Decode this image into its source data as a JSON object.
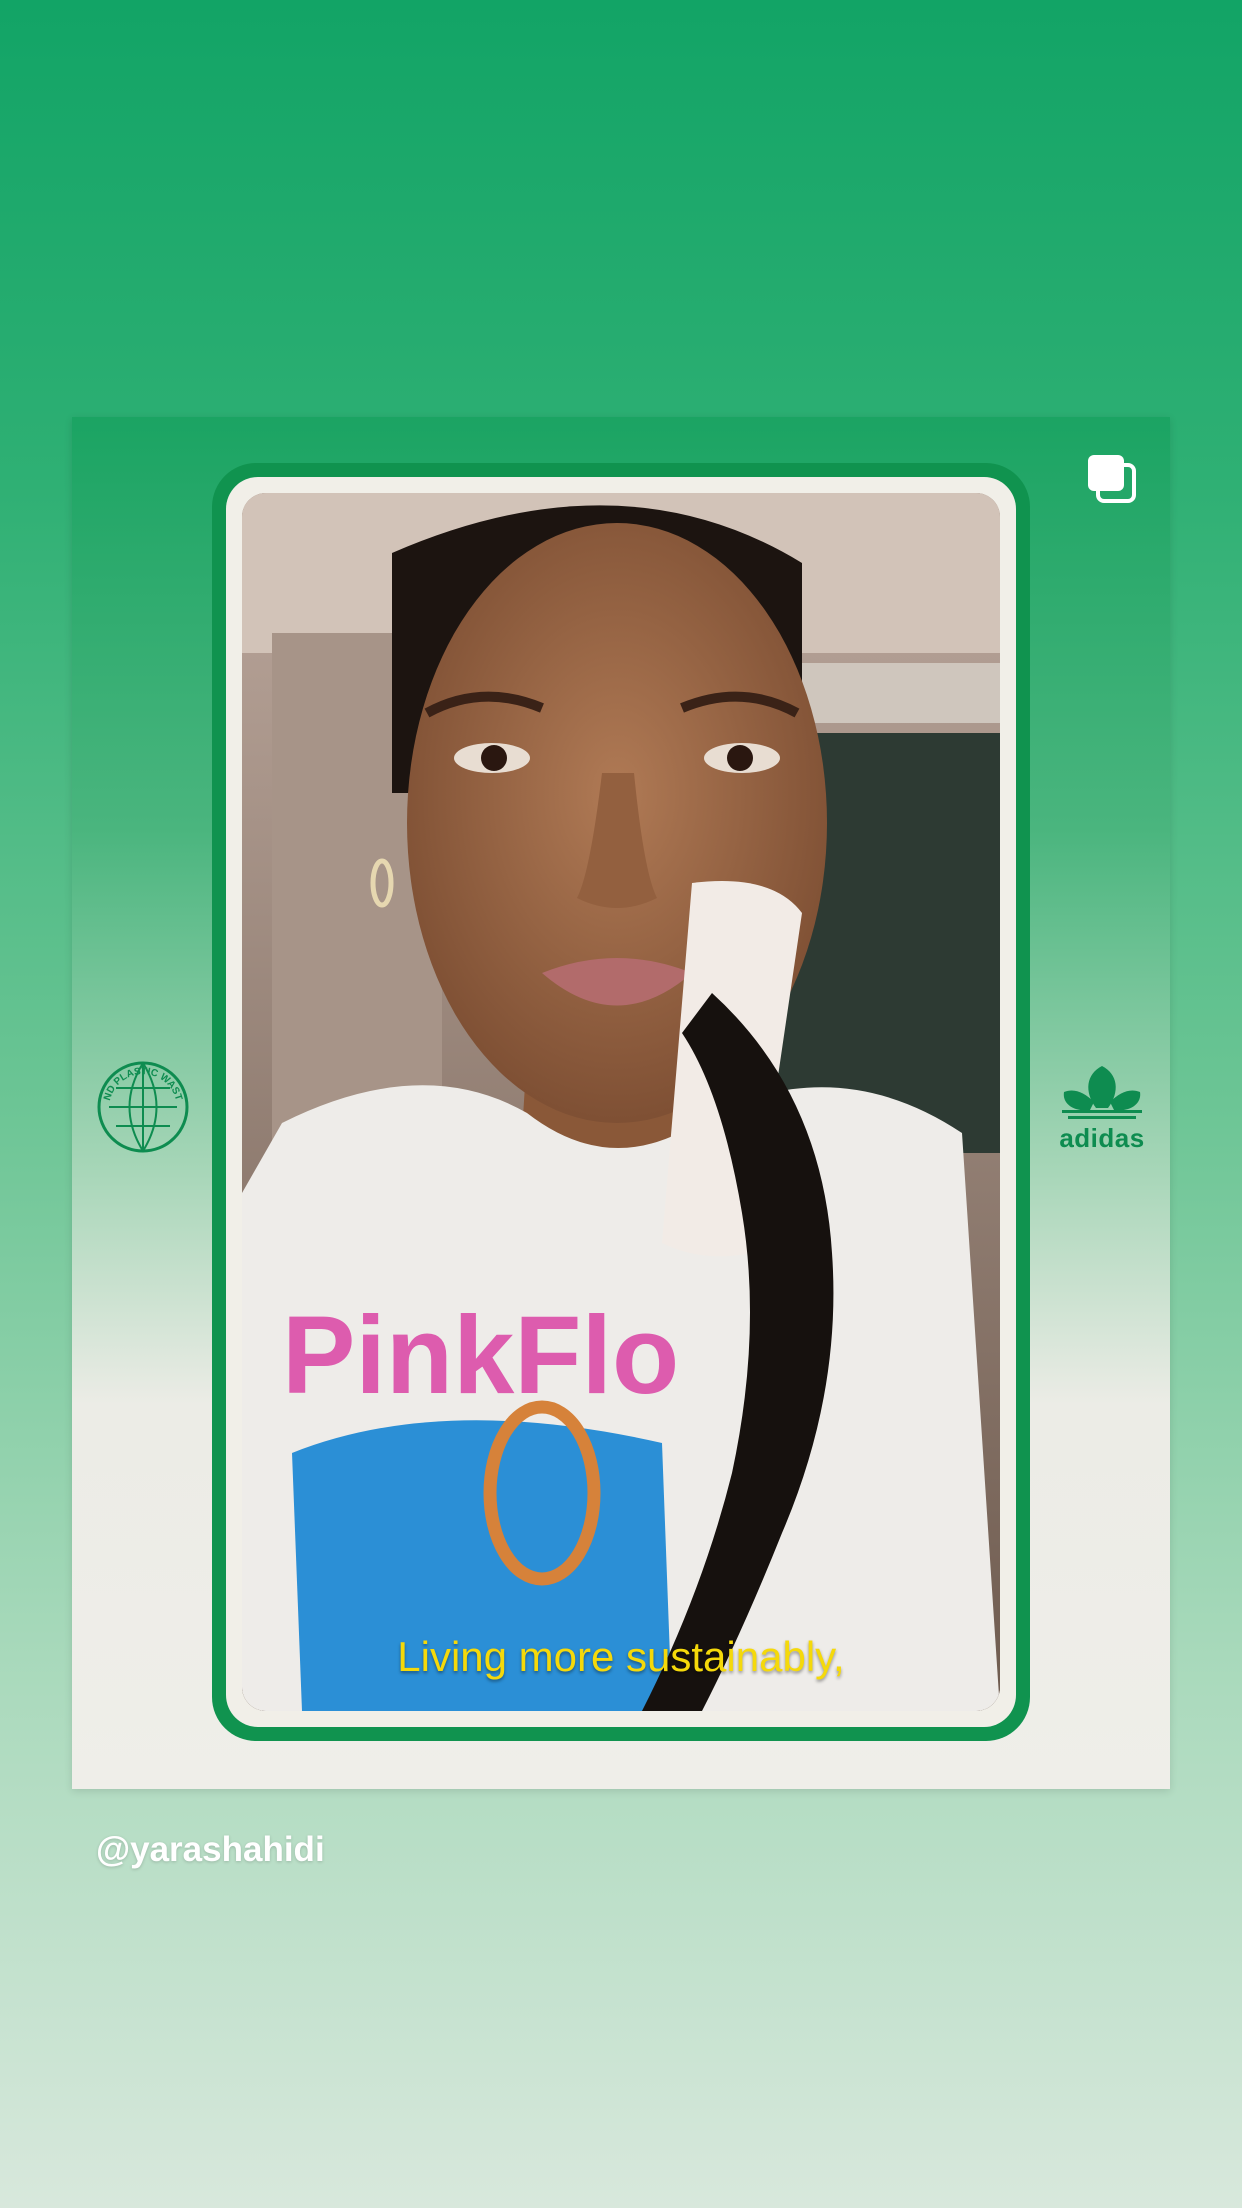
{
  "post": {
    "subtitle": "Living more sustainably,",
    "shirt_text": "PinkFlo",
    "badge_text": "END PLASTIC WASTE",
    "brand": "adidas",
    "username": "@yarashahidi"
  },
  "icons": {
    "multi_post": "stacked-squares-icon",
    "badge": "globe-icon",
    "brand_logo": "trefoil-icon"
  },
  "colors": {
    "brand_green": "#10934f",
    "subtitle_yellow": "#f5d90a"
  }
}
